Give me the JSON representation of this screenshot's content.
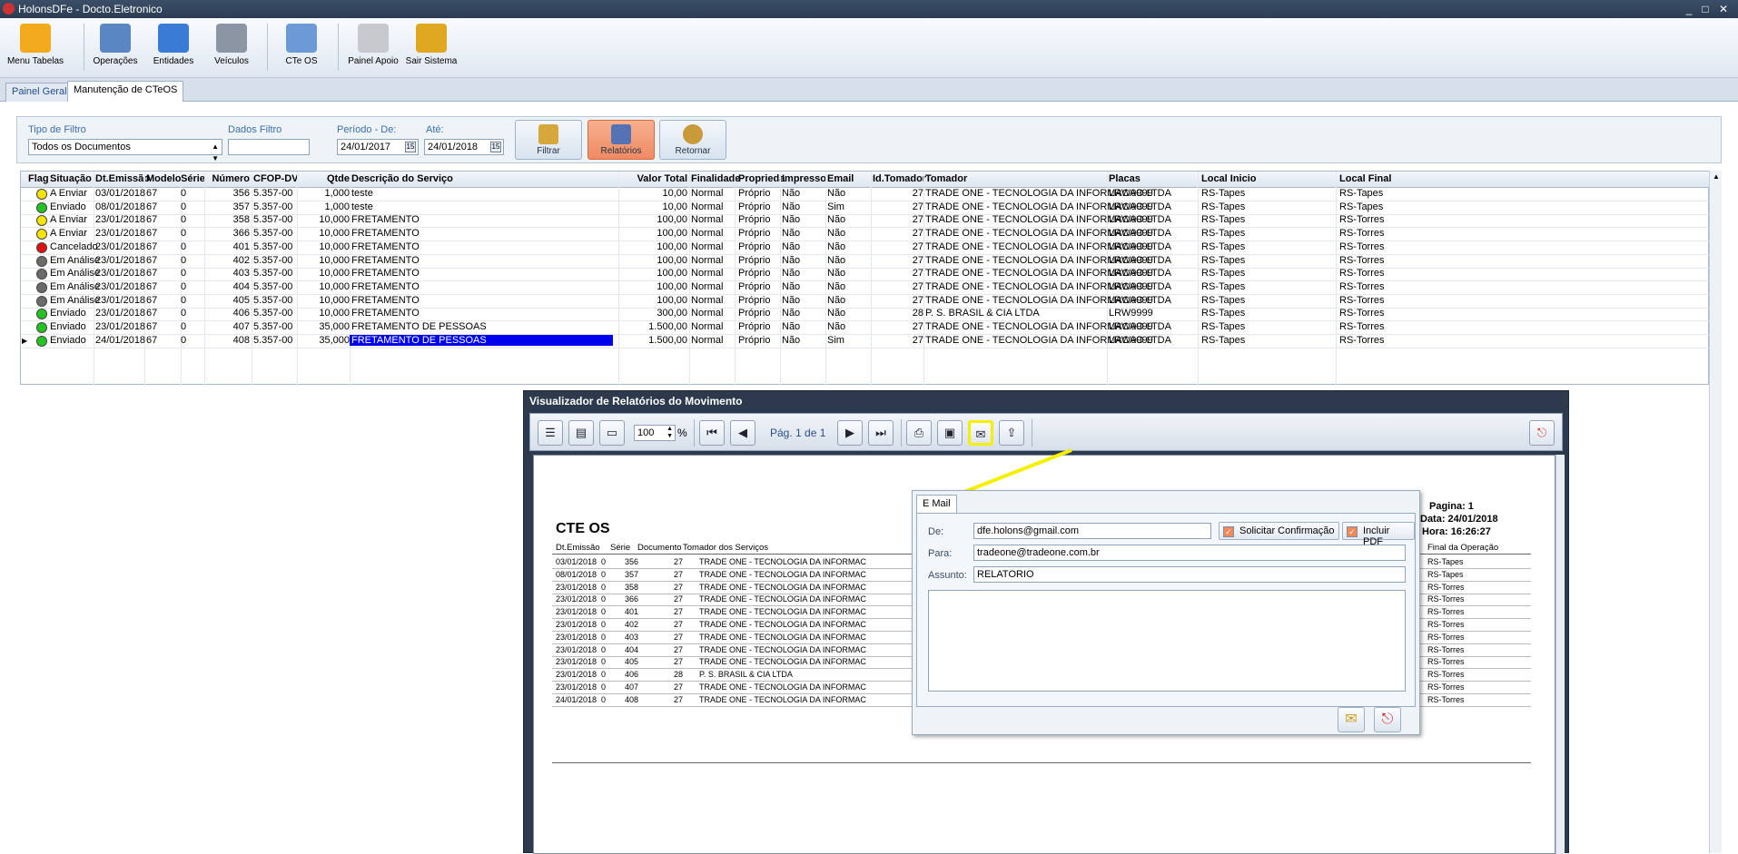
{
  "window": {
    "title": "HolonsDFe - Docto.Eletronico",
    "controls": [
      "_",
      "□",
      "✕"
    ]
  },
  "toolbar": {
    "buttons": [
      {
        "label": "Menu Tabelas",
        "icon": "tag-icon",
        "color": "#f2a91b"
      },
      {
        "label": "Operações",
        "icon": "network-add-icon",
        "color": "#5b86c4"
      },
      {
        "label": "Entidades",
        "icon": "database-add-icon",
        "color": "#3a7bd5"
      },
      {
        "label": "Veículos",
        "icon": "truck-add-icon",
        "color": "#8c95a3"
      },
      {
        "label": "CTe OS",
        "icon": "document-add-icon",
        "color": "#6b9ad6"
      },
      {
        "label": "Painel Apoio",
        "icon": "chart-icon",
        "color": "#c7c9cf"
      },
      {
        "label": "Sair Sistema",
        "icon": "exit-door-icon",
        "color": "#e0a820"
      }
    ]
  },
  "tabs": [
    {
      "label": "Painel Geral",
      "active": false
    },
    {
      "label": "Manutenção de CTeOS",
      "active": true
    }
  ],
  "filter": {
    "tipo_label": "Tipo de Filtro",
    "tipo_value": "Todos os Documentos",
    "dados_label": "Dados Filtro",
    "dados_value": "",
    "periodo_label": "Período - De:",
    "periodo_de": "24/01/2017",
    "ate_label": "Até:",
    "periodo_ate": "24/01/2018",
    "cal_glyph": "15",
    "buttons": [
      {
        "label": "Filtrar",
        "icon": "database-filter-icon"
      },
      {
        "label": "Relatórios",
        "icon": "report-icon",
        "active": true
      },
      {
        "label": "Retornar",
        "icon": "return-icon"
      }
    ]
  },
  "grid": {
    "columns": [
      "Flag",
      "Situação",
      "Dt.Emissão",
      "Modelo",
      "Série",
      "Número",
      "CFOP-DV",
      "Qtde",
      "Descrição do Serviço",
      "Valor Total",
      "Finalidade",
      "Proprieda",
      "Impresso",
      "Email",
      "Id.Tomador",
      "Tomador",
      "Placas",
      "Local Inicio",
      "Local Final"
    ],
    "status_colors": {
      "yellow": "#f5e400",
      "green": "#22c322",
      "red": "#e01010",
      "gray": "#6b6b6b"
    },
    "rows": [
      {
        "flag": "yellow",
        "situacao": "A Enviar",
        "data": "03/01/2018",
        "modelo": "67",
        "serie": "0",
        "numero": "356",
        "cfop": "5.357-00",
        "qtde": "1,000",
        "descricao": "teste",
        "valor": "10,00",
        "finalidade": "Normal",
        "propriedade": "Próprio",
        "impresso": "Não",
        "email": "Não",
        "idtomador": "27",
        "tomador": "TRADE ONE - TECNOLOGIA DA INFORMACAO LTDA",
        "placas": "LRW9999",
        "inicio": "RS-Tapes",
        "final": "RS-Tapes"
      },
      {
        "flag": "green",
        "situacao": "Enviado",
        "data": "08/01/2018",
        "modelo": "67",
        "serie": "0",
        "numero": "357",
        "cfop": "5.357-00",
        "qtde": "1,000",
        "descricao": "teste",
        "valor": "10,00",
        "finalidade": "Normal",
        "propriedade": "Próprio",
        "impresso": "Não",
        "email": "Sim",
        "idtomador": "27",
        "tomador": "TRADE ONE - TECNOLOGIA DA INFORMACAO LTDA",
        "placas": "LRW9999",
        "inicio": "RS-Tapes",
        "final": "RS-Tapes"
      },
      {
        "flag": "yellow",
        "situacao": "A Enviar",
        "data": "23/01/2018",
        "modelo": "67",
        "serie": "0",
        "numero": "358",
        "cfop": "5.357-00",
        "qtde": "10,000",
        "descricao": "FRETAMENTO",
        "valor": "100,00",
        "finalidade": "Normal",
        "propriedade": "Próprio",
        "impresso": "Não",
        "email": "Não",
        "idtomador": "27",
        "tomador": "TRADE ONE - TECNOLOGIA DA INFORMACAO LTDA",
        "placas": "LRW9999",
        "inicio": "RS-Tapes",
        "final": "RS-Torres"
      },
      {
        "flag": "yellow",
        "situacao": "A Enviar",
        "data": "23/01/2018",
        "modelo": "67",
        "serie": "0",
        "numero": "366",
        "cfop": "5.357-00",
        "qtde": "10,000",
        "descricao": "FRETAMENTO",
        "valor": "100,00",
        "finalidade": "Normal",
        "propriedade": "Próprio",
        "impresso": "Não",
        "email": "Não",
        "idtomador": "27",
        "tomador": "TRADE ONE - TECNOLOGIA DA INFORMACAO LTDA",
        "placas": "LRW9999",
        "inicio": "RS-Tapes",
        "final": "RS-Torres"
      },
      {
        "flag": "red",
        "situacao": "Cancelado",
        "data": "23/01/2018",
        "modelo": "67",
        "serie": "0",
        "numero": "401",
        "cfop": "5.357-00",
        "qtde": "10,000",
        "descricao": "FRETAMENTO",
        "valor": "100,00",
        "finalidade": "Normal",
        "propriedade": "Próprio",
        "impresso": "Não",
        "email": "Não",
        "idtomador": "27",
        "tomador": "TRADE ONE - TECNOLOGIA DA INFORMACAO LTDA",
        "placas": "LRW9999",
        "inicio": "RS-Tapes",
        "final": "RS-Torres"
      },
      {
        "flag": "gray",
        "situacao": "Em Análise",
        "data": "23/01/2018",
        "modelo": "67",
        "serie": "0",
        "numero": "402",
        "cfop": "5.357-00",
        "qtde": "10,000",
        "descricao": "FRETAMENTO",
        "valor": "100,00",
        "finalidade": "Normal",
        "propriedade": "Próprio",
        "impresso": "Não",
        "email": "Não",
        "idtomador": "27",
        "tomador": "TRADE ONE - TECNOLOGIA DA INFORMACAO LTDA",
        "placas": "LRW9999",
        "inicio": "RS-Tapes",
        "final": "RS-Torres"
      },
      {
        "flag": "gray",
        "situacao": "Em Análise",
        "data": "23/01/2018",
        "modelo": "67",
        "serie": "0",
        "numero": "403",
        "cfop": "5.357-00",
        "qtde": "10,000",
        "descricao": "FRETAMENTO",
        "valor": "100,00",
        "finalidade": "Normal",
        "propriedade": "Próprio",
        "impresso": "Não",
        "email": "Não",
        "idtomador": "27",
        "tomador": "TRADE ONE - TECNOLOGIA DA INFORMACAO LTDA",
        "placas": "LRW9999",
        "inicio": "RS-Tapes",
        "final": "RS-Torres"
      },
      {
        "flag": "gray",
        "situacao": "Em Análise",
        "data": "23/01/2018",
        "modelo": "67",
        "serie": "0",
        "numero": "404",
        "cfop": "5.357-00",
        "qtde": "10,000",
        "descricao": "FRETAMENTO",
        "valor": "100,00",
        "finalidade": "Normal",
        "propriedade": "Próprio",
        "impresso": "Não",
        "email": "Não",
        "idtomador": "27",
        "tomador": "TRADE ONE - TECNOLOGIA DA INFORMACAO LTDA",
        "placas": "LRW9999",
        "inicio": "RS-Tapes",
        "final": "RS-Torres"
      },
      {
        "flag": "gray",
        "situacao": "Em Análise",
        "data": "23/01/2018",
        "modelo": "67",
        "serie": "0",
        "numero": "405",
        "cfop": "5.357-00",
        "qtde": "10,000",
        "descricao": "FRETAMENTO",
        "valor": "100,00",
        "finalidade": "Normal",
        "propriedade": "Próprio",
        "impresso": "Não",
        "email": "Não",
        "idtomador": "27",
        "tomador": "TRADE ONE - TECNOLOGIA DA INFORMACAO LTDA",
        "placas": "LRW9999",
        "inicio": "RS-Tapes",
        "final": "RS-Torres"
      },
      {
        "flag": "green",
        "situacao": "Enviado",
        "data": "23/01/2018",
        "modelo": "67",
        "serie": "0",
        "numero": "406",
        "cfop": "5.357-00",
        "qtde": "10,000",
        "descricao": "FRETAMENTO",
        "valor": "300,00",
        "finalidade": "Normal",
        "propriedade": "Próprio",
        "impresso": "Não",
        "email": "Não",
        "idtomador": "28",
        "tomador": "P. S. BRASIL & CIA LTDA",
        "placas": "LRW9999",
        "inicio": "RS-Tapes",
        "final": "RS-Torres"
      },
      {
        "flag": "green",
        "situacao": "Enviado",
        "data": "23/01/2018",
        "modelo": "67",
        "serie": "0",
        "numero": "407",
        "cfop": "5.357-00",
        "qtde": "35,000",
        "descricao": "FRETAMENTO DE PESSOAS",
        "valor": "1.500,00",
        "finalidade": "Normal",
        "propriedade": "Próprio",
        "impresso": "Não",
        "email": "Não",
        "idtomador": "27",
        "tomador": "TRADE ONE - TECNOLOGIA DA INFORMACAO LTDA",
        "placas": "LRW9999",
        "inicio": "RS-Tapes",
        "final": "RS-Torres"
      },
      {
        "flag": "green",
        "situacao": "Enviado",
        "data": "24/01/2018",
        "modelo": "67",
        "serie": "0",
        "numero": "408",
        "cfop": "5.357-00",
        "qtde": "35,000",
        "descricao": "FRETAMENTO DE PESSOAS",
        "valor": "1.500,00",
        "finalidade": "Normal",
        "propriedade": "Próprio",
        "impresso": "Não",
        "email": "Sim",
        "idtomador": "27",
        "tomador": "TRADE ONE - TECNOLOGIA DA INFORMACAO LTDA",
        "placas": "LRW9999",
        "inicio": "RS-Tapes",
        "final": "RS-Torres",
        "selected": true
      }
    ]
  },
  "viewer": {
    "title": "Visualizador de Relatórios do Movimento",
    "zoom": "100",
    "zoom_unit": "%",
    "page_label": "Pág. 1 de 1",
    "highlight_color": "#f4f000"
  },
  "report": {
    "title": "CTE OS",
    "pagina": "Pagina:  1",
    "data": "Data: 24/01/2018",
    "hora": "Hora: 16:26:27",
    "columns": [
      "Dt.Emissão",
      "Série",
      "Documento",
      "Tomador dos Serviços",
      "Final da Operação"
    ],
    "rows": [
      {
        "data": "03/01/2018",
        "serie": "0",
        "doc": "356",
        "tom": "27",
        "nome": "TRADE ONE - TECNOLOGIA DA INFORMAC",
        "final": "RS-Tapes"
      },
      {
        "data": "08/01/2018",
        "serie": "0",
        "doc": "357",
        "tom": "27",
        "nome": "TRADE ONE - TECNOLOGIA DA INFORMAC",
        "final": "RS-Tapes"
      },
      {
        "data": "23/01/2018",
        "serie": "0",
        "doc": "358",
        "tom": "27",
        "nome": "TRADE ONE - TECNOLOGIA DA INFORMAC",
        "final": "RS-Torres"
      },
      {
        "data": "23/01/2018",
        "serie": "0",
        "doc": "366",
        "tom": "27",
        "nome": "TRADE ONE - TECNOLOGIA DA INFORMAC",
        "final": "RS-Torres"
      },
      {
        "data": "23/01/2018",
        "serie": "0",
        "doc": "401",
        "tom": "27",
        "nome": "TRADE ONE - TECNOLOGIA DA INFORMAC",
        "final": "RS-Torres"
      },
      {
        "data": "23/01/2018",
        "serie": "0",
        "doc": "402",
        "tom": "27",
        "nome": "TRADE ONE - TECNOLOGIA DA INFORMAC",
        "final": "RS-Torres"
      },
      {
        "data": "23/01/2018",
        "serie": "0",
        "doc": "403",
        "tom": "27",
        "nome": "TRADE ONE - TECNOLOGIA DA INFORMAC",
        "final": "RS-Torres"
      },
      {
        "data": "23/01/2018",
        "serie": "0",
        "doc": "404",
        "tom": "27",
        "nome": "TRADE ONE - TECNOLOGIA DA INFORMAC",
        "final": "RS-Torres"
      },
      {
        "data": "23/01/2018",
        "serie": "0",
        "doc": "405",
        "tom": "27",
        "nome": "TRADE ONE - TECNOLOGIA DA INFORMAC",
        "final": "RS-Torres"
      },
      {
        "data": "23/01/2018",
        "serie": "0",
        "doc": "406",
        "tom": "28",
        "nome": "P. S. BRASIL & CIA LTDA",
        "final": "RS-Torres"
      },
      {
        "data": "23/01/2018",
        "serie": "0",
        "doc": "407",
        "tom": "27",
        "nome": "TRADE ONE - TECNOLOGIA DA INFORMAC",
        "final": "RS-Torres"
      },
      {
        "data": "24/01/2018",
        "serie": "0",
        "doc": "408",
        "tom": "27",
        "nome": "TRADE ONE - TECNOLOGIA DA INFORMAC",
        "final": "RS-Torres"
      }
    ]
  },
  "email": {
    "tab": "E Mail",
    "de_label": "De:",
    "de_value": "dfe.holons@gmail.com",
    "para_label": "Para:",
    "para_value": "tradeone@tradeone.com.br",
    "assunto_label": "Assunto:",
    "assunto_value": "RELATORIO",
    "body": "",
    "solicitar": "Solicitar Confirmação",
    "incluir_pdf": "Incluir PDF",
    "check_glyph": "✓"
  }
}
